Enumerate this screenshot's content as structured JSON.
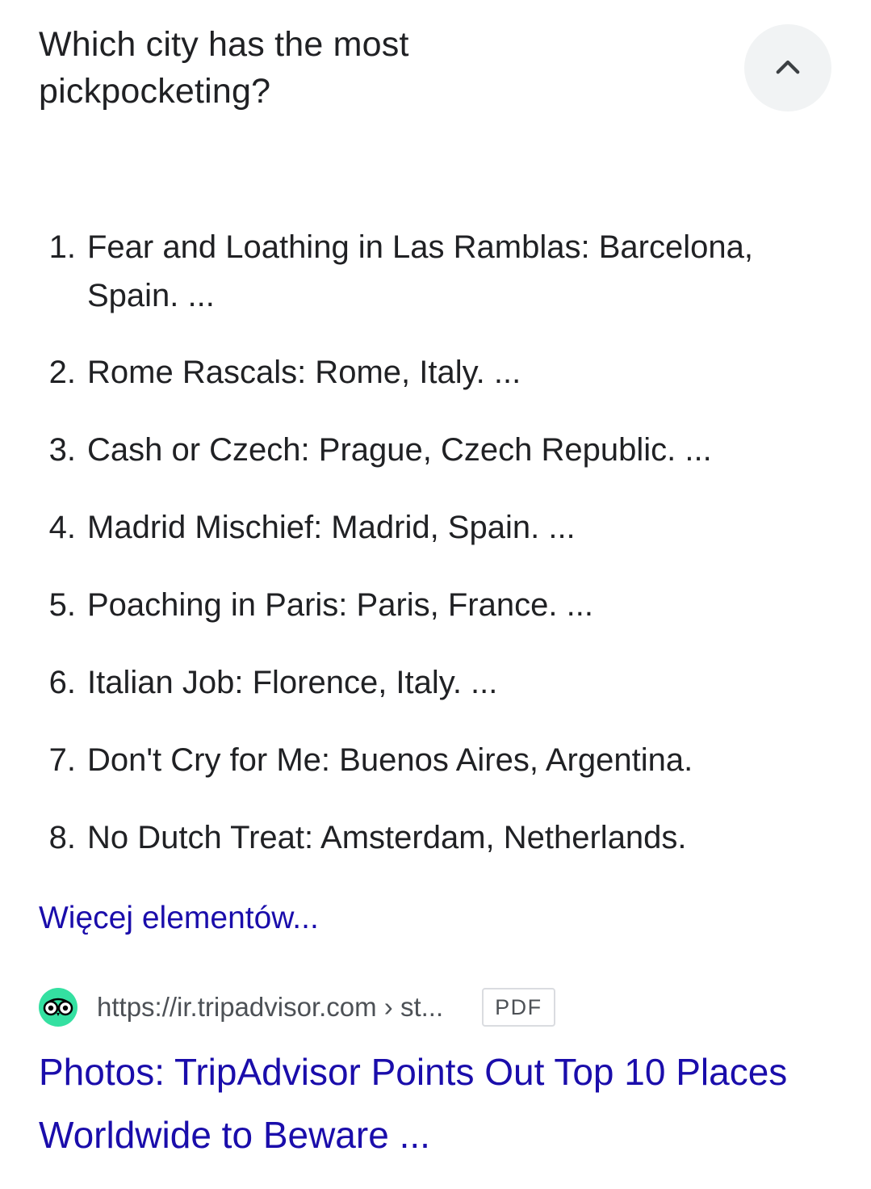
{
  "question": {
    "title_line1": "Which city has the most",
    "title_line2": "pickpocketing?",
    "collapse_icon": "chevron-up-icon"
  },
  "answer": {
    "items": [
      {
        "number": "1.",
        "text": "Fear and Loathing in Las Ramblas: Barcelona, Spain. ..."
      },
      {
        "number": "2.",
        "text": "Rome Rascals: Rome, Italy. ..."
      },
      {
        "number": "3.",
        "text": "Cash or Czech: Prague, Czech Republic. ..."
      },
      {
        "number": "4.",
        "text": "Madrid Mischief: Madrid, Spain. ..."
      },
      {
        "number": "5.",
        "text": "Poaching in Paris: Paris, France. ..."
      },
      {
        "number": "6.",
        "text": "Italian Job: Florence, Italy. ..."
      },
      {
        "number": "7.",
        "text": "Don't Cry for Me: Buenos Aires, Argentina."
      },
      {
        "number": "8.",
        "text": "No Dutch Treat: Amsterdam, Netherlands."
      }
    ],
    "more_link": "Więcej elementów..."
  },
  "source": {
    "favicon": "tripadvisor-owl-icon",
    "favicon_color": "#34e0a1",
    "url": "https://ir.tripadvisor.com › st...",
    "badge": "PDF",
    "title": "Photos: TripAdvisor Points Out Top 10 Places Worldwide to Beware ..."
  },
  "colors": {
    "link": "#1a0dab",
    "text": "#202124",
    "secondary": "#4d5156",
    "button_bg": "#f1f3f4"
  }
}
